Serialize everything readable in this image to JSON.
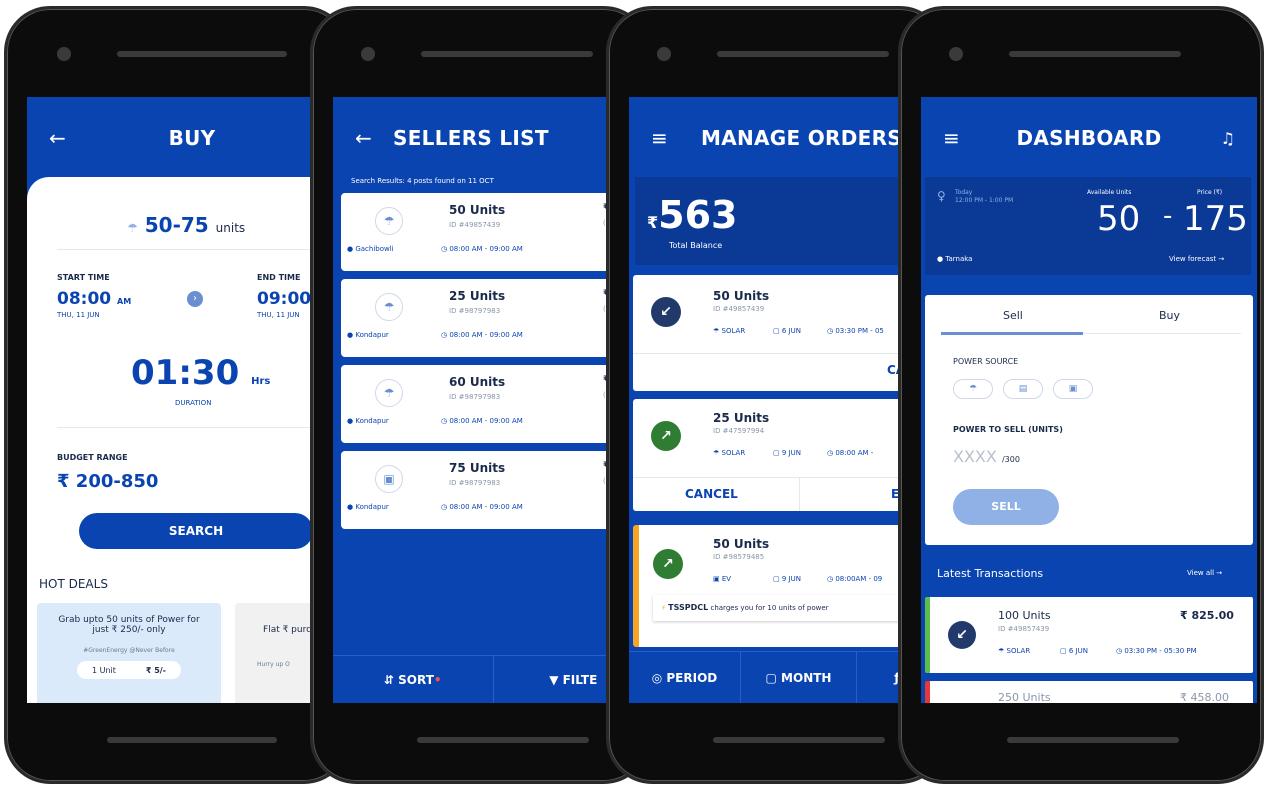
{
  "colors": {
    "primary": "#0a44b0",
    "navy": "#223a6b",
    "green": "#2e7d32",
    "orange": "#f5a623",
    "accent_light": "#8fb1e5"
  },
  "buy": {
    "title": "BUY",
    "units": "50-75",
    "units_suffix": "units",
    "start_label": "START TIME",
    "start_time": "08:00",
    "start_ampm": "AM",
    "start_date": "THU, 11 JUN",
    "end_label": "END TIME",
    "end_time": "09:00",
    "end_date": "THU, 11 JUN",
    "duration": "01:30",
    "duration_unit": "Hrs",
    "duration_label": "DURATION",
    "budget_label": "BUDGET RANGE",
    "budget": "₹ 200-850",
    "search_label": "SEARCH",
    "hot_deals": "HOT DEALS",
    "deal1_text": "Grab upto 50 units of Power for just ₹ 250/- only",
    "deal1_tags": "#GreenEnergy @Never Before",
    "deal1_unit": "1 Unit",
    "deal1_price": "₹ 5/-",
    "deal2_text": "Flat ₹ purchas",
    "deal2_sub": "Hurry up O"
  },
  "sellers": {
    "title": "SELLERS LIST",
    "results": "Search Results: 4 posts found on 11 OCT",
    "items": [
      {
        "units": "50 Units",
        "id": "ID #49857439",
        "location": "Gachibowli",
        "time": "08:00 AM - 09:00 AM",
        "price": "₹",
        "note": "(P"
      },
      {
        "units": "25 Units",
        "id": "ID #98797983",
        "location": "Kondapur",
        "time": "08:00 AM - 09:00 AM",
        "price": "₹",
        "note": "(Pe"
      },
      {
        "units": "60 Units",
        "id": "ID #98797983",
        "location": "Kondapur",
        "time": "08:00 AM - 09:00 AM",
        "price": "₹",
        "note": "(P"
      },
      {
        "units": "75 Units",
        "id": "ID #98797983",
        "location": "Kondapur",
        "time": "08:00 AM - 09:00 AM",
        "price": "₹",
        "note": "(Pe"
      }
    ],
    "sort_label": "SORT",
    "filter_label": "FILTE"
  },
  "orders": {
    "title": "MANAGE ORDERS",
    "balance_symbol": "₹",
    "balance": "563",
    "balance_label": "Total Balance",
    "items": [
      {
        "units": "50 Units",
        "id": "ID #49857439",
        "source": "SOLAR",
        "date": "6 JUN",
        "time": "03:30 PM - 05",
        "action1": "CANC"
      },
      {
        "units": "25 Units",
        "id": "ID #47597994",
        "source": "SOLAR",
        "date": "9 JUN",
        "time": "08:00 AM -",
        "action1": "CANCEL",
        "action2": "EDIT"
      },
      {
        "units": "50 Units",
        "id": "ID #98579485",
        "source": "EV",
        "date": "9 JUN",
        "time": "08:00AM - 09"
      }
    ],
    "tsspdcl": "TSSPDCL",
    "tsspdcl_note": "charges you for 10 units of power",
    "period": "PERIOD",
    "month": "MONTH",
    "third": "F"
  },
  "dashboard": {
    "title": "DASHBOARD",
    "today_label": "Today",
    "today_time": "12:00 PM - 1:00 PM",
    "avail_label": "Available Units",
    "price_label": "Price (₹)",
    "avail": "50",
    "price": "175",
    "location": "Tarnaka",
    "forecast": "View forecast",
    "tab_sell": "Sell",
    "tab_buy": "Buy",
    "power_source": "POWER SOURCE",
    "power_to_sell": "POWER TO SELL (UNITS)",
    "placeholder": "XXXX",
    "max": "/300",
    "sell_btn": "SELL",
    "latest": "Latest Transactions",
    "view_all": "View all",
    "tx": [
      {
        "units": "100 Units",
        "id": "ID #49857439",
        "amount": "₹ 825.00",
        "source": "SOLAR",
        "date": "6 JUN",
        "time": "03:30 PM - 05:30 PM"
      },
      {
        "units": "250 Units",
        "amount": "₹ 458.00"
      }
    ]
  }
}
